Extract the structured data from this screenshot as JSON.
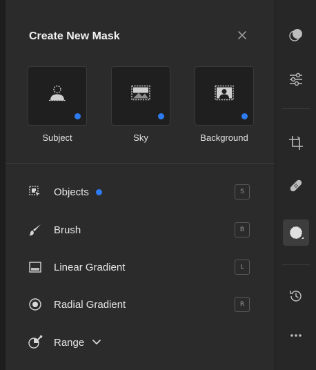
{
  "panel": {
    "title": "Create New Mask",
    "close_icon": "close-icon"
  },
  "quick_masks": [
    {
      "label": "Subject",
      "icon": "subject-icon"
    },
    {
      "label": "Sky",
      "icon": "sky-icon"
    },
    {
      "label": "Background",
      "icon": "background-icon"
    }
  ],
  "tools": [
    {
      "label": "Objects",
      "icon": "objects-icon",
      "shortcut": "S"
    },
    {
      "label": "Brush",
      "icon": "brush-icon",
      "shortcut": "B"
    },
    {
      "label": "Linear Gradient",
      "icon": "linear-gradient-icon",
      "shortcut": "L"
    },
    {
      "label": "Radial Gradient",
      "icon": "radial-gradient-icon",
      "shortcut": "R"
    },
    {
      "label": "Range",
      "icon": "range-icon"
    }
  ],
  "right_toolbar": [
    "edit-icon",
    "adjustments-icon",
    "crop-icon",
    "healing-icon",
    "masking-icon",
    "history-icon",
    "more-icon"
  ],
  "colors": {
    "accent": "#2d7bf0",
    "panel_bg": "#2b2b2b",
    "toolbar_bg": "#272727"
  }
}
